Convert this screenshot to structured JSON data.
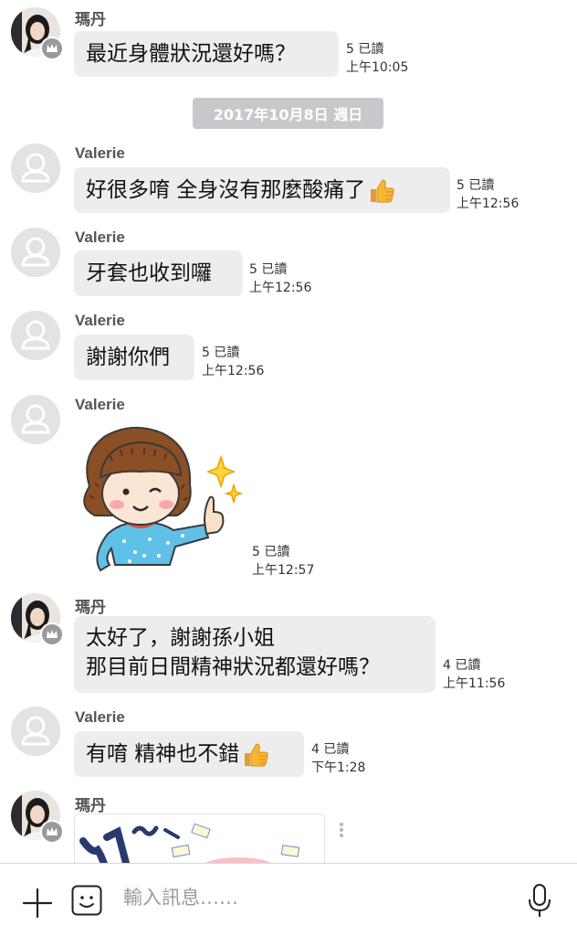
{
  "messages": [
    {
      "sender": "瑪丹",
      "text": "最近身體狀況還好嗎？",
      "read": "5 已讀",
      "time": "上午10:05"
    },
    {
      "sender": "Valerie",
      "text": "好很多唷 全身沒有那麼酸痛了",
      "read": "5 已讀",
      "time": "上午12:56"
    },
    {
      "sender": "Valerie",
      "text": "牙套也收到囉",
      "read": "5 已讀",
      "time": "上午12:56"
    },
    {
      "sender": "Valerie",
      "text": "謝謝你們",
      "read": "5 已讀",
      "time": "上午12:56"
    },
    {
      "sender": "Valerie",
      "read": "5 已讀",
      "time": "上午12:57"
    },
    {
      "sender": "瑪丹",
      "line1": "太好了，謝謝孫小姐",
      "line2": "那目前日間精神狀況都還好嗎？",
      "read": "4 已讀",
      "time": "上午11:56"
    },
    {
      "sender": "Valerie",
      "text": "有唷 精神也不錯",
      "read": "4 已讀",
      "time": "下午1:28"
    },
    {
      "sender": "瑪丹"
    }
  ],
  "date_separator": "2017年10月8日 週日",
  "input": {
    "placeholder": "輸入訊息……"
  },
  "icons": {
    "plus": "plus-icon",
    "emoji": "emoji-icon",
    "mic": "microphone-icon",
    "thumb": "thumbs-up-emoji",
    "crown": "crown-icon",
    "more": "more-options-icon"
  },
  "colors": {
    "bubble": "#ededed",
    "date_pill": "#c8c8cc",
    "sticker_shirt": "#5fc0e8",
    "sticker_hair": "#8a4f25"
  }
}
